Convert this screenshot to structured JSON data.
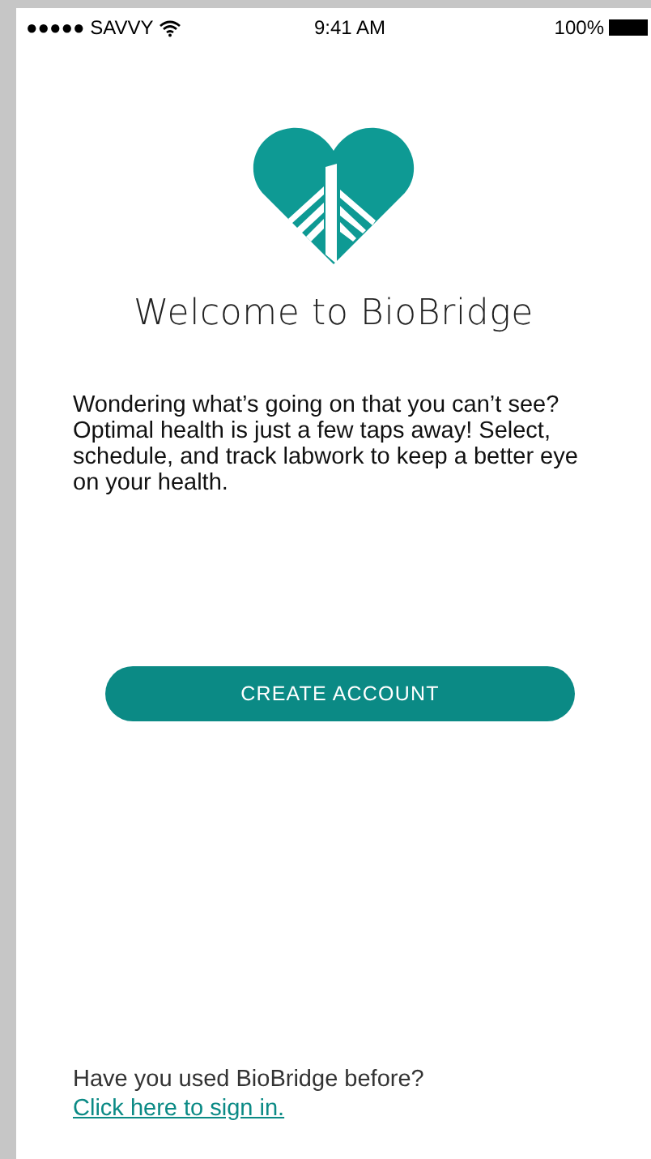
{
  "status_bar": {
    "carrier": "●●●●● SAVVY",
    "time": "9:41 AM",
    "battery": "100%"
  },
  "title": "Welcome to BioBridge",
  "intro": "Wondering what’s going on that you can’t see? Optimal health is just a few taps away! Select, schedule, and track labwork to keep a better eye on your health.",
  "primary_button": "CREATE ACCOUNT",
  "footer": {
    "question": "Have you used BioBridge before?",
    "link": "Click here to sign in."
  }
}
